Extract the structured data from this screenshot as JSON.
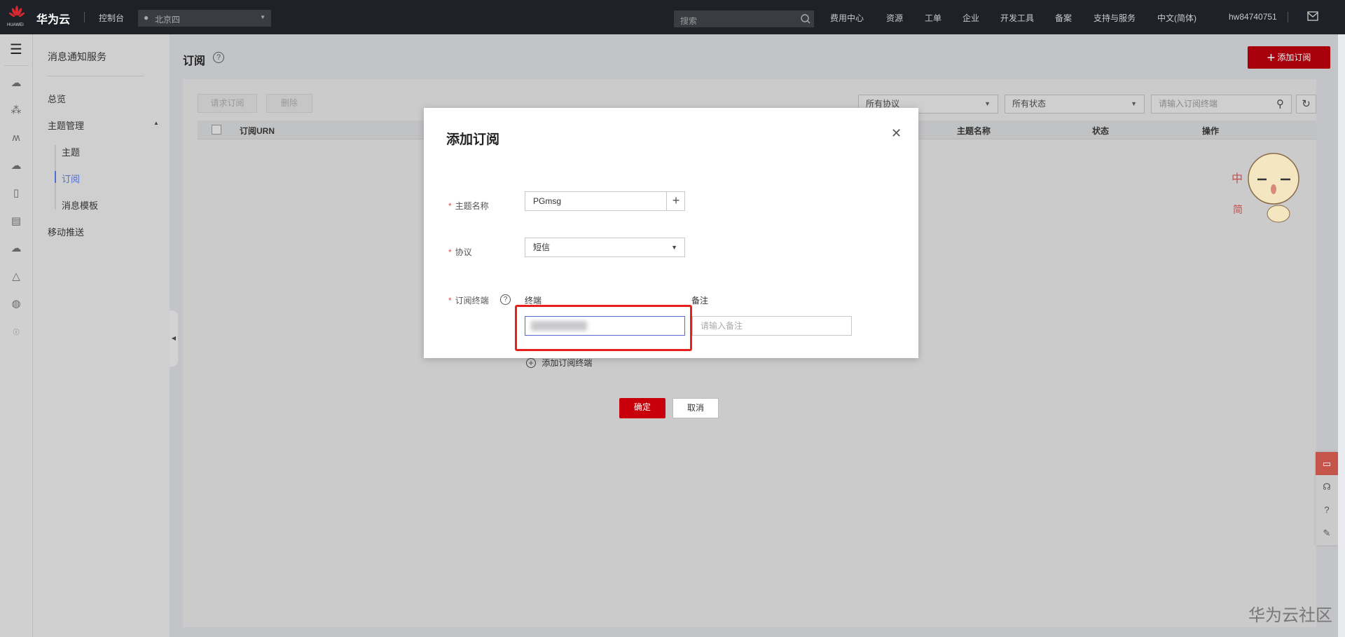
{
  "topbar": {
    "logo_text": "HUAWEI",
    "brand": "华为云",
    "console": "控制台",
    "region": "北京四",
    "search_placeholder": "搜索",
    "nav": [
      "费用中心",
      "资源",
      "工单",
      "企业",
      "开发工具",
      "备案",
      "支持与服务",
      "中文(简体)"
    ],
    "user": "hw84740751"
  },
  "sidebar": {
    "title": "消息通知服务",
    "items": [
      {
        "label": "总览"
      },
      {
        "label": "主题管理"
      },
      {
        "label": "主题"
      },
      {
        "label": "订阅",
        "active": true
      },
      {
        "label": "消息模板"
      },
      {
        "label": "移动推送"
      }
    ]
  },
  "page": {
    "title": "订阅",
    "add_button": "添加订阅",
    "toolbar": {
      "request": "请求订阅",
      "delete": "删除"
    },
    "filters": {
      "protocol": "所有协议",
      "status": "所有状态",
      "search_placeholder": "请输入订阅终端"
    },
    "columns": [
      "订阅URN",
      "主题名称",
      "状态",
      "操作"
    ]
  },
  "dialog": {
    "title": "添加订阅",
    "topic_label": "主题名称",
    "topic_value": "PGmsg",
    "protocol_label": "协议",
    "protocol_value": "短信",
    "endpoint_label": "订阅终端",
    "endpoint_col": "终端",
    "remark_col": "备注",
    "remark_placeholder": "请输入备注",
    "add_endpoint": "添加订阅终端",
    "ok": "确定",
    "cancel": "取消"
  },
  "watermark": "华为云社区",
  "colors": {
    "brand_red": "#c7000b",
    "highlight_box": "#e8201b",
    "active_nav": "#526ecc"
  }
}
